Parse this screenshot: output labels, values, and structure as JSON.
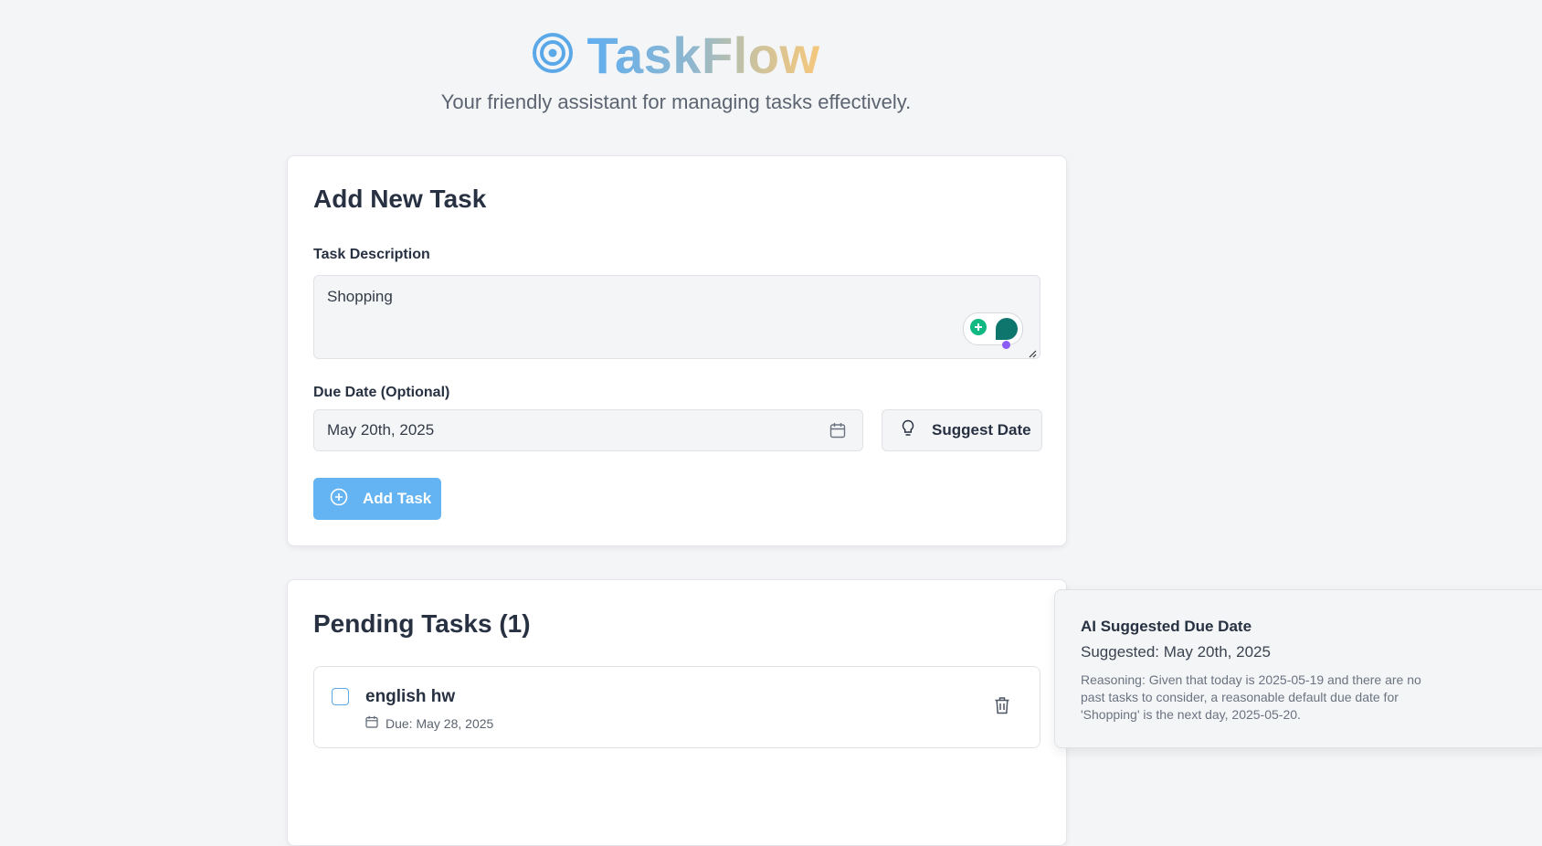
{
  "header": {
    "title": "TaskFlow",
    "subtitle": "Your friendly assistant for managing tasks effectively."
  },
  "add_task": {
    "heading": "Add New Task",
    "description_label": "Task Description",
    "description_value": "Shopping",
    "due_date_label": "Due Date (Optional)",
    "due_date_value": "May 20th, 2025",
    "suggest_button": "Suggest Date",
    "add_button": "Add Task"
  },
  "pending": {
    "heading": "Pending Tasks (1)",
    "tasks": [
      {
        "name": "english hw",
        "due": "Due: May 28, 2025",
        "completed": false
      }
    ]
  },
  "toast": {
    "title": "AI Suggested Due Date",
    "suggested": "Suggested: May 20th, 2025",
    "reasoning": "Reasoning: Given that today is 2025-05-19 and there are no past tasks to consider, a reasonable default due date for 'Shopping' is the next day, 2025-05-20."
  },
  "colors": {
    "accent": "#64b3f2",
    "logo_blue": "#5aa8e8",
    "background": "#f4f5f7",
    "assistant_green": "#0f766e"
  },
  "icons": [
    "target-icon",
    "calendar-icon",
    "lightbulb-icon",
    "plus-circle-icon",
    "trash-icon",
    "assistant-widget-icon"
  ]
}
